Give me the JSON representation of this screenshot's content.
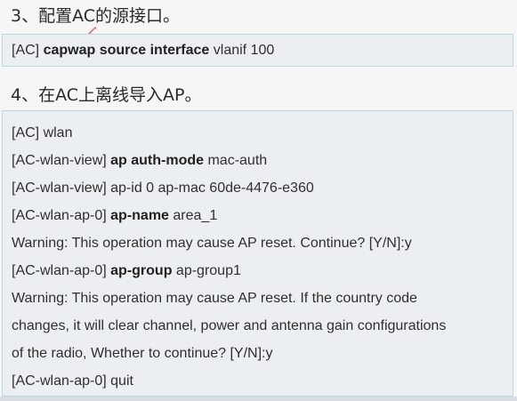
{
  "section3": {
    "heading": "3、配置AC的源接口。",
    "command": {
      "prefix": "[AC] ",
      "keyword": "capwap source interface",
      "suffix": " vlanif 100"
    }
  },
  "section4": {
    "heading": "4、在AC上离线导入AP。",
    "lines": [
      {
        "prefix": "[AC] wlan",
        "keyword": "",
        "suffix": ""
      },
      {
        "prefix": "[AC-wlan-view] ",
        "keyword": "ap auth-mode",
        "suffix": " mac-auth"
      },
      {
        "prefix": "[AC-wlan-view] ap-id 0 ap-mac 60de-4476-e360",
        "keyword": "",
        "suffix": ""
      },
      {
        "prefix": "[AC-wlan-ap-0] ",
        "keyword": "ap-name",
        "suffix": " area_1"
      },
      {
        "prefix": "Warning: This operation may cause AP reset. Continue? [Y/N]:y",
        "keyword": "",
        "suffix": ""
      },
      {
        "prefix": "[AC-wlan-ap-0] ",
        "keyword": "ap-group",
        "suffix": " ap-group1"
      },
      {
        "prefix": "Warning: This operation may cause AP reset. If the country code",
        "keyword": "",
        "suffix": ""
      },
      {
        "prefix": "changes, it will clear channel, power and antenna gain configurations",
        "keyword": "",
        "suffix": ""
      },
      {
        "prefix": "of the radio, Whether to continue? [Y/N]:y",
        "keyword": "",
        "suffix": ""
      },
      {
        "prefix": "[AC-wlan-ap-0] quit",
        "keyword": "",
        "suffix": ""
      }
    ]
  }
}
